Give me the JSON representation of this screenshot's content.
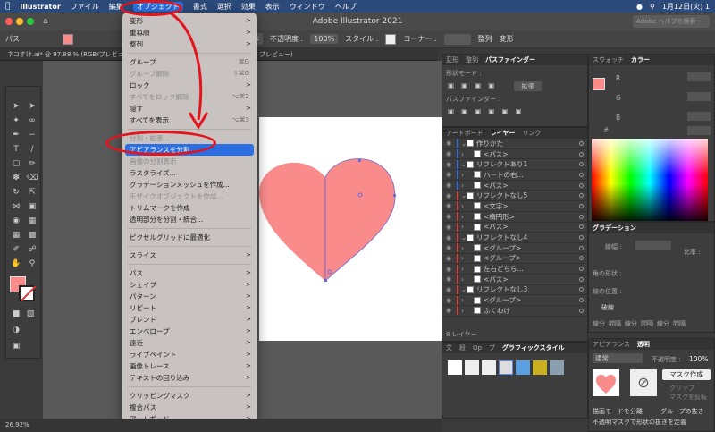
{
  "menubar": {
    "app": "Illustrator",
    "items": [
      "ファイル",
      "編集",
      "オブジェクト",
      "書式",
      "選択",
      "効果",
      "表示",
      "ウィンドウ",
      "ヘルプ"
    ],
    "clock": "1月12日(火) 1"
  },
  "titlebar": {
    "title": "Adobe Illustrator 2021",
    "help_placeholder": "Adobe ヘルプを検索"
  },
  "controlbar": {
    "path_label": "パス",
    "stroke_label": "基本",
    "opacity_label": "不透明度 :",
    "opacity_value": "100%",
    "style_label": "スタイル :",
    "corner_label": "コーナー :",
    "align_label": "整列",
    "transform_label": "変形"
  },
  "doctab": {
    "left": "ネコすけ.ai* @ 97.88 % (RGB/プレビュー)",
    "right": "ブレビュー)"
  },
  "menu": {
    "items": [
      {
        "label": "変形",
        "arrow": ">",
        "type": "item"
      },
      {
        "label": "重ね順",
        "arrow": ">",
        "type": "item"
      },
      {
        "label": "整列",
        "arrow": ">",
        "type": "item"
      },
      {
        "type": "sep"
      },
      {
        "label": "グループ",
        "sc": "⌘G",
        "type": "item"
      },
      {
        "label": "グループ解除",
        "sc": "⇧⌘G",
        "type": "disabled"
      },
      {
        "label": "ロック",
        "arrow": ">",
        "type": "item"
      },
      {
        "label": "すべてをロック解除",
        "sc": "⌥⌘2",
        "type": "disabled"
      },
      {
        "label": "隠す",
        "arrow": ">",
        "type": "item"
      },
      {
        "label": "すべてを表示",
        "sc": "⌥⌘3",
        "type": "item"
      },
      {
        "type": "sep"
      },
      {
        "label": "分割・拡張...",
        "type": "disabled"
      },
      {
        "label": "アピアランスを分割",
        "type": "selected"
      },
      {
        "label": "画像の分割表示",
        "type": "disabled"
      },
      {
        "label": "ラスタライズ...",
        "type": "item"
      },
      {
        "label": "グラデーションメッシュを作成...",
        "type": "item"
      },
      {
        "label": "モザイクオブジェクトを作成...",
        "type": "disabled"
      },
      {
        "label": "トリムマークを作成",
        "type": "item"
      },
      {
        "label": "透明部分を分割・統合...",
        "type": "item"
      },
      {
        "type": "sep"
      },
      {
        "label": "ピクセルグリッドに最適化",
        "type": "item"
      },
      {
        "type": "sep"
      },
      {
        "label": "スライス",
        "arrow": ">",
        "type": "item"
      },
      {
        "type": "sep"
      },
      {
        "label": "パス",
        "arrow": ">",
        "type": "item"
      },
      {
        "label": "シェイプ",
        "arrow": ">",
        "type": "item"
      },
      {
        "label": "パターン",
        "arrow": ">",
        "type": "item"
      },
      {
        "label": "リピート",
        "arrow": ">",
        "type": "item"
      },
      {
        "label": "ブレンド",
        "arrow": ">",
        "type": "item"
      },
      {
        "label": "エンベロープ",
        "arrow": ">",
        "type": "item"
      },
      {
        "label": "遠近",
        "arrow": ">",
        "type": "item"
      },
      {
        "label": "ライブペイント",
        "arrow": ">",
        "type": "item"
      },
      {
        "label": "画像トレース",
        "arrow": ">",
        "type": "item"
      },
      {
        "label": "テキストの回り込み",
        "arrow": ">",
        "type": "item"
      },
      {
        "type": "sep"
      },
      {
        "label": "クリッピングマスク",
        "arrow": ">",
        "type": "item"
      },
      {
        "label": "複合パス",
        "arrow": ">",
        "type": "item"
      },
      {
        "label": "アートボード",
        "arrow": ">",
        "type": "item"
      },
      {
        "label": "グラフ",
        "arrow": ">",
        "type": "item"
      }
    ]
  },
  "pathfinder": {
    "tabs": [
      "変形",
      "整列",
      "パスファインダー"
    ],
    "shape_mode": "形状モード :",
    "expand": "拡張",
    "pathfinder_label": "パスファインダー :"
  },
  "layers": {
    "tabs": [
      "アートボード",
      "レイヤー",
      "リンク"
    ],
    "rows": [
      {
        "label": "作りかた",
        "bar": "#3b6bd6",
        "indent": 0
      },
      {
        "label": "<パス>",
        "bar": "#3b6bd6",
        "indent": 1
      },
      {
        "label": "リフレクトあり1",
        "bar": "#3b6bd6",
        "indent": 0
      },
      {
        "label": "ハートの右...",
        "bar": "#3b6bd6",
        "indent": 1
      },
      {
        "label": "<パス>",
        "bar": "#3b6bd6",
        "indent": 1
      },
      {
        "label": "リフレクトなし5",
        "bar": "#d64040",
        "indent": 0
      },
      {
        "label": "<文字>",
        "bar": "#d64040",
        "indent": 1
      },
      {
        "label": "<楕円形>",
        "bar": "#d64040",
        "indent": 1
      },
      {
        "label": "<パス>",
        "bar": "#d64040",
        "indent": 1
      },
      {
        "label": "リフレクトなし4",
        "bar": "#d64040",
        "indent": 0
      },
      {
        "label": "<グループ>",
        "bar": "#d64040",
        "indent": 1
      },
      {
        "label": "<グループ>",
        "bar": "#d64040",
        "indent": 1
      },
      {
        "label": "左右どちら...",
        "bar": "#d64040",
        "indent": 1
      },
      {
        "label": "<パス>",
        "bar": "#d64040",
        "indent": 1
      },
      {
        "label": "リフレクトなし3",
        "bar": "#d64040",
        "indent": 0
      },
      {
        "label": "<グループ>",
        "bar": "#d64040",
        "indent": 1
      },
      {
        "label": "ふくわけ",
        "bar": "#d64040",
        "indent": 1
      }
    ],
    "footer": "8 レイヤー"
  },
  "graphic_styles": {
    "tabs": [
      "文",
      "段",
      "Op",
      "ブ",
      "グラフィックスタイル"
    ]
  },
  "swatch_panel": {
    "tabs": [
      "スウォッチ",
      "カラー"
    ],
    "channels": [
      "R",
      "G",
      "B"
    ],
    "hex_label": "#"
  },
  "gradient_panel": {
    "tab": "グラデーション",
    "type_label": "種類 :",
    "stroke_label": "線幅 :",
    "angle_label": "角の形状 :",
    "align_label": "線の位置 :",
    "ratio_label": "比率 :",
    "dashed_label": "破線",
    "dash_labels": [
      "線分",
      "間隔",
      "線分",
      "間隔",
      "線分",
      "間隔"
    ]
  },
  "transparency": {
    "tabs": [
      "アピアランス",
      "透明"
    ],
    "mode": "通常",
    "opacity_label": "不透明度 :",
    "opacity_value": "100%",
    "make_mask": "マスク作成",
    "clip": "クリップ",
    "invert": "マスクを反転",
    "isolate": "描画モードを分離",
    "knockout": "グループの抜き",
    "opacity_mask": "不透明マスクで形状の抜きを定義"
  },
  "status": {
    "zoom": "26.92%"
  },
  "colors": {
    "heart": "#fa8b8b",
    "menu_highlight": "#2d6fe0",
    "annotation": "#e3141c"
  }
}
